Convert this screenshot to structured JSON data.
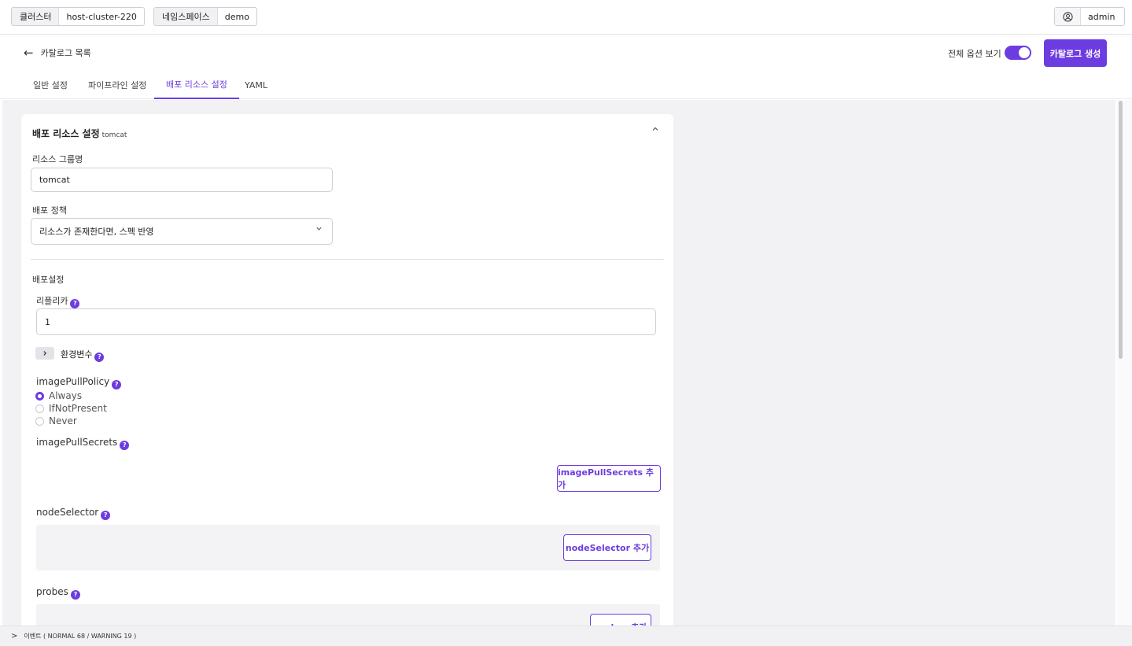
{
  "topbar": {
    "cluster_key": "클러스터",
    "cluster_value": "host-cluster-220",
    "namespace_key": "네임스페이스",
    "namespace_value": "demo",
    "user_icon": "user-circle-icon",
    "user_name": "admin"
  },
  "header": {
    "back_icon": "arrow-left-icon",
    "back_label": "카탈로그 목록",
    "show_all_label": "전체 옵션 보기",
    "show_all_enabled": true,
    "create_button": "카탈로그 생성"
  },
  "tabs": [
    {
      "label": "일반 설정",
      "active": false
    },
    {
      "label": "파이프라인 설정",
      "active": false
    },
    {
      "label": "배포 리소스 설정",
      "active": true
    },
    {
      "label": "YAML",
      "active": false
    }
  ],
  "card": {
    "title": "배포 리소스 설정",
    "subtitle": "tomcat",
    "collapse_icon": "chevron-up-icon",
    "resource_group_label": "리소스 그룹명",
    "resource_group_value": "tomcat",
    "deploy_policy_label": "배포 정책",
    "deploy_policy_value": "리소스가 존재한다면, 스펙 반영",
    "deploy_settings_label": "배포설정",
    "replica_label": "리플리카",
    "replica_value": "1",
    "env_label": "환경변수",
    "image_pull_policy_label": "imagePullPolicy",
    "image_pull_policy_options": [
      "Always",
      "IfNotPresent",
      "Never"
    ],
    "image_pull_policy_selected": "Always",
    "image_pull_secrets_label": "imagePullSecrets",
    "image_pull_secrets_add": "imagePullSecrets 추가",
    "node_selector_label": "nodeSelector",
    "node_selector_add": "nodeSelector 추가",
    "probes_label": "probes",
    "probes_add": "probes 추가",
    "help_glyph": "?"
  },
  "bottombar": {
    "events_label": "이벤트 ( NORMAL 68 / WARNING 19 )"
  },
  "colors": {
    "accent": "#6d3ce0",
    "background": "#f2f2f4"
  }
}
